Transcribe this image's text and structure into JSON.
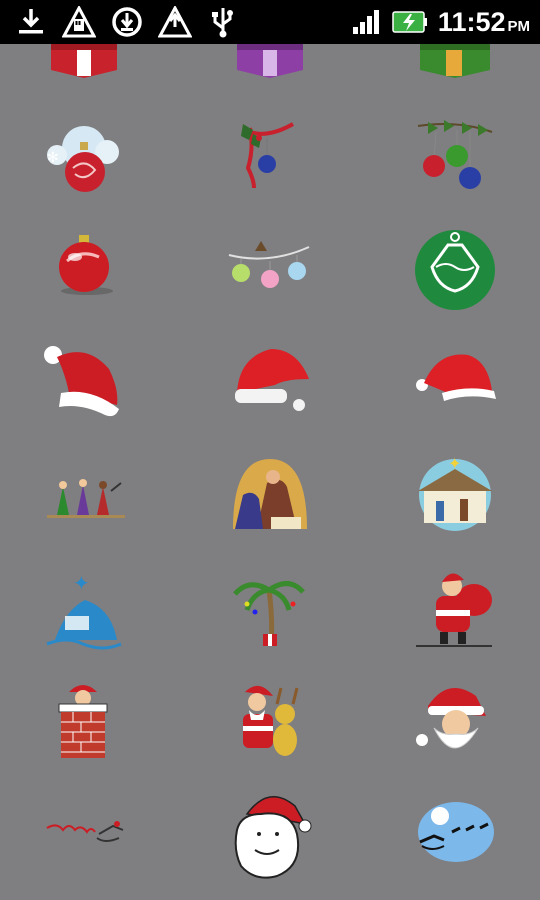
{
  "status_bar": {
    "time": "11:52",
    "ampm": "PM",
    "notification_icons": [
      "download-icon",
      "sd-card-warning-icon",
      "sync-icon",
      "warning-icon",
      "usb-icon"
    ],
    "signal_icon": "signal-bars-icon",
    "battery_icon": "battery-charging-icon"
  },
  "grid": {
    "columns": 3,
    "items": [
      {
        "name": "gift-red",
        "col": 0,
        "row": 0
      },
      {
        "name": "gift-purple",
        "col": 1,
        "row": 0
      },
      {
        "name": "gift-green",
        "col": 2,
        "row": 0
      },
      {
        "name": "snowy-ornament",
        "col": 0,
        "row": 1
      },
      {
        "name": "holly-ribbon-ornament",
        "col": 1,
        "row": 1
      },
      {
        "name": "three-ornaments-branch",
        "col": 2,
        "row": 1
      },
      {
        "name": "red-ball-ornament",
        "col": 0,
        "row": 2
      },
      {
        "name": "hanging-ornaments-garland",
        "col": 1,
        "row": 2
      },
      {
        "name": "green-ornament-badge",
        "col": 2,
        "row": 2
      },
      {
        "name": "santa-hat-1",
        "col": 0,
        "row": 3
      },
      {
        "name": "santa-hat-2",
        "col": 1,
        "row": 3
      },
      {
        "name": "santa-hat-3",
        "col": 2,
        "row": 3
      },
      {
        "name": "three-wise-men",
        "col": 0,
        "row": 4
      },
      {
        "name": "holy-family",
        "col": 1,
        "row": 4
      },
      {
        "name": "nativity-stable",
        "col": 2,
        "row": 4
      },
      {
        "name": "bethlehem-star-village",
        "col": 0,
        "row": 5
      },
      {
        "name": "christmas-palm-tree",
        "col": 1,
        "row": 5
      },
      {
        "name": "santa-with-sack",
        "col": 2,
        "row": 5
      },
      {
        "name": "santa-in-chimney",
        "col": 0,
        "row": 6
      },
      {
        "name": "santa-with-reindeer",
        "col": 1,
        "row": 6
      },
      {
        "name": "santa-face",
        "col": 2,
        "row": 6
      },
      {
        "name": "sleigh-signature",
        "col": 0,
        "row": 7
      },
      {
        "name": "santa-head-line-art",
        "col": 1,
        "row": 7
      },
      {
        "name": "sleigh-over-moon",
        "col": 2,
        "row": 7
      }
    ]
  }
}
